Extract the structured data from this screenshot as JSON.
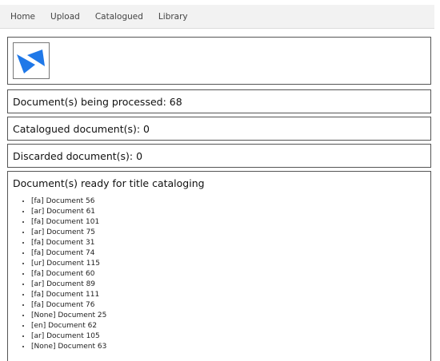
{
  "nav": {
    "items": [
      "Home",
      "Upload",
      "Catalogued",
      "Library"
    ]
  },
  "logo": {
    "icon": "blue-logo-icon",
    "color": "#1f78e8"
  },
  "stats": {
    "processing": "Document(s) being processed: 68",
    "catalogued": "Catalogued document(s): 0",
    "discarded": "Discarded document(s): 0"
  },
  "ready": {
    "title": "Document(s) ready for title cataloging",
    "documents": [
      "[fa] Document 56",
      "[ar] Document 61",
      "[fa] Document 101",
      "[ar] Document 75",
      "[fa] Document 31",
      "[fa] Document 74",
      "[ur] Document 115",
      "[fa] Document 60",
      "[ar] Document 89",
      "[fa] Document 111",
      "[fa] Document 76",
      "[None] Document 25",
      "[en] Document 62",
      "[ar] Document 105",
      "[None] Document 63"
    ]
  }
}
